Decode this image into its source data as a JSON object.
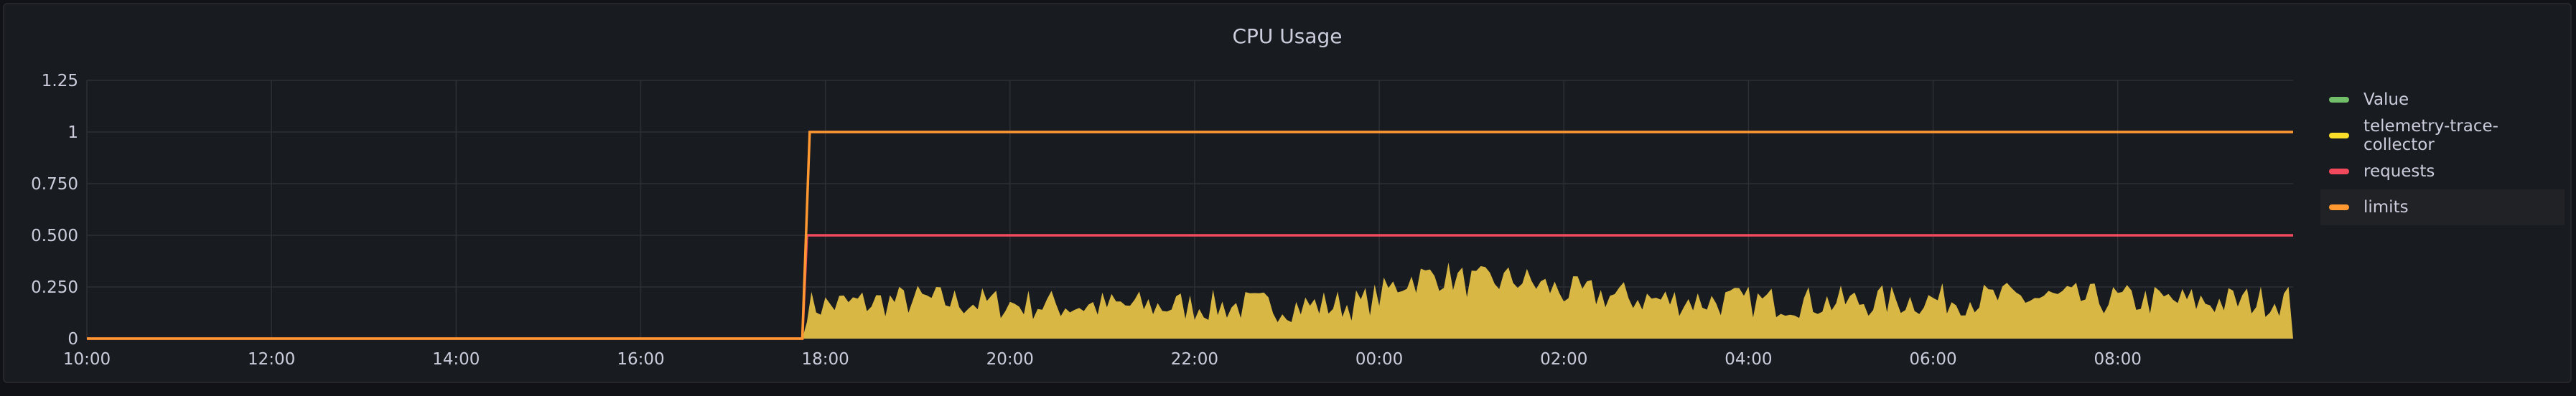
{
  "chart_data": {
    "type": "area",
    "title": "CPU Usage",
    "xlabel": "",
    "ylabel": "",
    "x_tick_labels": [
      "10:00",
      "12:00",
      "14:00",
      "16:00",
      "18:00",
      "20:00",
      "22:00",
      "00:00",
      "02:00",
      "04:00",
      "06:00",
      "08:00"
    ],
    "y_tick_labels": [
      "0",
      "0.250",
      "0.500",
      "0.750",
      "1",
      "1.25"
    ],
    "x_range_hours": [
      10,
      33.9
    ],
    "ylim": [
      0,
      1.25
    ],
    "grid": true,
    "legend_position": "right",
    "series": [
      {
        "name": "Value",
        "color": "#73bf69",
        "style": "line",
        "values": []
      },
      {
        "name": "telemetry-trace-collector",
        "color": "#fade2a",
        "fill_color": "#d8b744",
        "style": "area",
        "x": [
          10,
          17.75,
          17.8,
          19,
          20,
          21,
          22,
          23,
          23.8,
          24,
          24.3,
          24.7,
          25,
          25.5,
          26,
          26.5,
          27,
          28,
          29,
          30,
          31,
          32,
          33,
          33.9
        ],
        "values": [
          0,
          0,
          0.15,
          0.18,
          0.16,
          0.15,
          0.15,
          0.15,
          0.16,
          0.2,
          0.28,
          0.3,
          0.26,
          0.28,
          0.22,
          0.2,
          0.18,
          0.17,
          0.17,
          0.18,
          0.19,
          0.18,
          0.17,
          0.18
        ]
      },
      {
        "name": "requests",
        "color": "#f2495c",
        "style": "line",
        "x": [
          10,
          17.75,
          17.8,
          33.9
        ],
        "values": [
          0,
          0,
          0.5,
          0.5
        ]
      },
      {
        "name": "limits",
        "color": "#ff9830",
        "style": "line",
        "x": [
          10,
          17.75,
          17.83,
          33.9
        ],
        "values": [
          0,
          0,
          1,
          1
        ]
      }
    ]
  }
}
